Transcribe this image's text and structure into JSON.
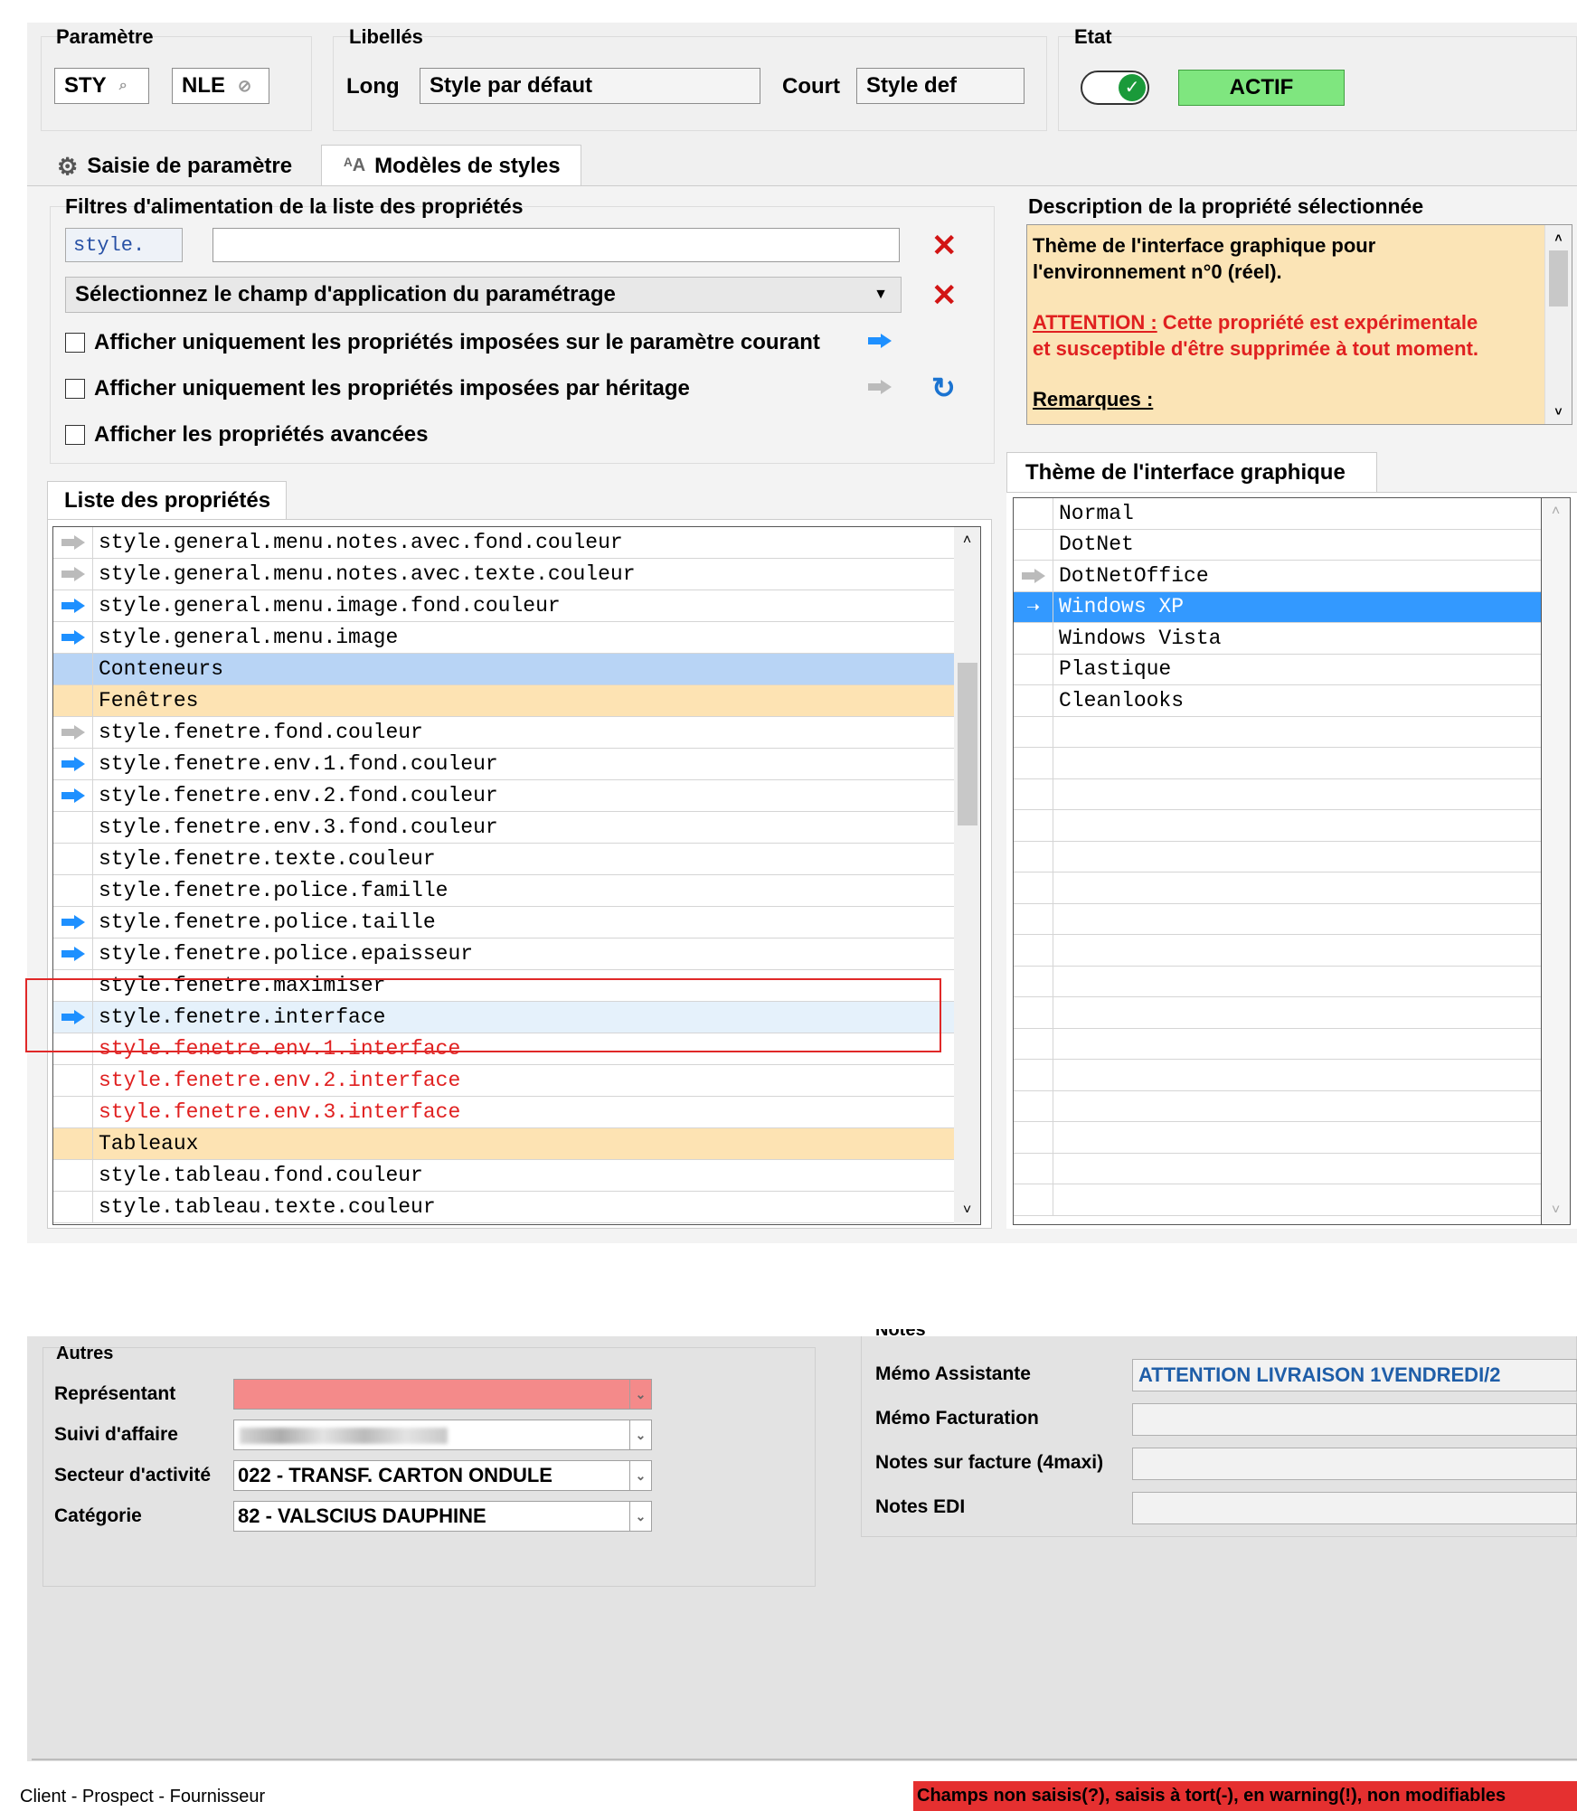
{
  "param": {
    "title": "Paramètre",
    "code1": "STY",
    "code2": "NLE"
  },
  "libelles": {
    "title": "Libellés",
    "long_label": "Long",
    "long_value": "Style par défaut",
    "court_label": "Court",
    "court_value": "Style def"
  },
  "etat": {
    "title": "Etat",
    "status": "ACTIF",
    "toggle_on": true
  },
  "tabs": [
    {
      "label": "Saisie de paramètre",
      "icon": "gear-icon"
    },
    {
      "label": "Modèles de styles",
      "icon": "font-icon",
      "active": true
    }
  ],
  "filters": {
    "title": "Filtres d'alimentation de la liste des propriétés",
    "prefix": "style.",
    "search_value": "",
    "scope_select": "Sélectionnez le champ d'application du paramétrage",
    "check1": "Afficher uniquement les propriétés imposées sur le paramètre courant",
    "check2": "Afficher uniquement les propriétés imposées par héritage",
    "check3": "Afficher les propriétés avancées"
  },
  "description": {
    "title": "Description de la propriété sélectionnée",
    "line1": "Thème de l'interface graphique pour",
    "line2": "l'environnement n°0 (réel).",
    "attention_label": "ATTENTION :",
    "attention_rest": " Cette propriété est expérimentale",
    "attention_line2": "et susceptible d'être supprimée à tout moment.",
    "remarques": "Remarques :"
  },
  "props_list": {
    "title": "Liste des propriétés",
    "rows": [
      {
        "icon": "grey",
        "text": "style.general.menu.notes.avec.fond.couleur",
        "kind": "normal"
      },
      {
        "icon": "grey",
        "text": "style.general.menu.notes.avec.texte.couleur",
        "kind": "normal"
      },
      {
        "icon": "blue",
        "text": "style.general.menu.image.fond.couleur",
        "kind": "normal"
      },
      {
        "icon": "blue",
        "text": "style.general.menu.image",
        "kind": "normal"
      },
      {
        "icon": "",
        "text": "Conteneurs",
        "kind": "group-blue"
      },
      {
        "icon": "",
        "text": "Fenêtres",
        "kind": "group-orange"
      },
      {
        "icon": "grey",
        "text": "style.fenetre.fond.couleur",
        "kind": "normal"
      },
      {
        "icon": "blue",
        "text": "style.fenetre.env.1.fond.couleur",
        "kind": "normal"
      },
      {
        "icon": "blue",
        "text": "style.fenetre.env.2.fond.couleur",
        "kind": "normal"
      },
      {
        "icon": "",
        "text": "style.fenetre.env.3.fond.couleur",
        "kind": "normal"
      },
      {
        "icon": "",
        "text": "style.fenetre.texte.couleur",
        "kind": "normal"
      },
      {
        "icon": "",
        "text": "style.fenetre.police.famille",
        "kind": "normal"
      },
      {
        "icon": "blue",
        "text": "style.fenetre.police.taille",
        "kind": "normal"
      },
      {
        "icon": "blue",
        "text": "style.fenetre.police.epaisseur",
        "kind": "normal"
      },
      {
        "icon": "",
        "text": "style.fenetre.maximiser",
        "kind": "normal"
      },
      {
        "icon": "blue",
        "text": "style.fenetre.interface",
        "kind": "selected"
      },
      {
        "icon": "",
        "text": "style.fenetre.env.1.interface",
        "kind": "red"
      },
      {
        "icon": "",
        "text": "style.fenetre.env.2.interface",
        "kind": "red"
      },
      {
        "icon": "",
        "text": "style.fenetre.env.3.interface",
        "kind": "red"
      },
      {
        "icon": "",
        "text": "Tableaux",
        "kind": "group-orange"
      },
      {
        "icon": "",
        "text": "style.tableau.fond.couleur",
        "kind": "normal"
      },
      {
        "icon": "",
        "text": "style.tableau.texte.couleur",
        "kind": "normal"
      }
    ]
  },
  "theme_list": {
    "title": "Thème de l'interface graphique",
    "rows": [
      {
        "icon": "",
        "text": "Normal",
        "selected": false
      },
      {
        "icon": "",
        "text": "DotNet",
        "selected": false
      },
      {
        "icon": "grey",
        "text": "DotNetOffice",
        "selected": false
      },
      {
        "icon": "white",
        "text": "Windows XP",
        "selected": true
      },
      {
        "icon": "",
        "text": "Windows Vista",
        "selected": false
      },
      {
        "icon": "",
        "text": "Plastique",
        "selected": false
      },
      {
        "icon": "",
        "text": "Cleanlooks",
        "selected": false
      }
    ]
  },
  "autres": {
    "title": "Autres",
    "rows": [
      {
        "label": "Représentant",
        "value": "",
        "pink": true
      },
      {
        "label": "Suivi d'affaire",
        "value": "",
        "blurred": true
      },
      {
        "label": "Secteur d'activité",
        "value": "022 - TRANSF. CARTON ONDULE"
      },
      {
        "label": "Catégorie",
        "value": "82 - VALSCIUS DAUPHINE"
      }
    ]
  },
  "notes": {
    "title": "Notes",
    "rows": [
      {
        "label": "Mémo Assistante",
        "value": "ATTENTION LIVRAISON 1VENDREDI/2"
      },
      {
        "label": "Mémo Facturation",
        "value": ""
      },
      {
        "label": "Notes sur facture (4maxi)",
        "value": ""
      },
      {
        "label": "Notes EDI",
        "value": ""
      }
    ]
  },
  "footer": {
    "left": "Client - Prospect - Fournisseur",
    "right": "Champs non saisis(?), saisis à tort(-), en warning(!), non modifiables"
  },
  "colors": {
    "accent": "#3399ff",
    "active_green": "#7fe67f",
    "warning_red": "#e53030",
    "group_orange": "#fde3b3",
    "group_blue": "#b8d4f5",
    "desc_bg": "#fbe4b6"
  }
}
